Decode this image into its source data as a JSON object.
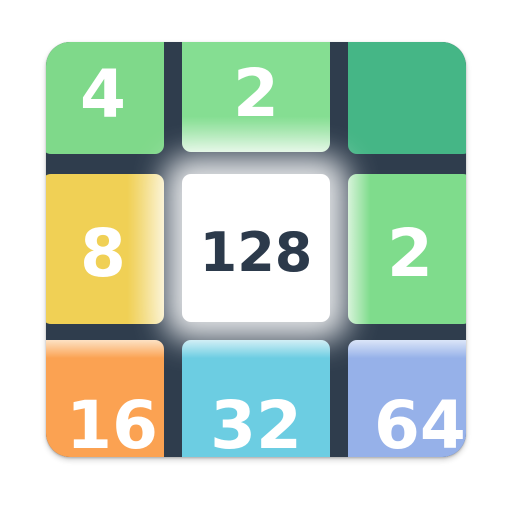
{
  "board": {
    "tiles": [
      {
        "value": "4",
        "color": "#7fd98a"
      },
      {
        "value": "2",
        "color": "#85de92"
      },
      {
        "value": "",
        "color": "#45b686"
      },
      {
        "value": "8",
        "color": "#f0d055"
      },
      {
        "value": "128",
        "color": "#ffffff"
      },
      {
        "value": "2",
        "color": "#7fdc8c"
      },
      {
        "value": "16",
        "color": "#fba252"
      },
      {
        "value": "32",
        "color": "#6ccde2"
      },
      {
        "value": "64",
        "color": "#96b1e9"
      }
    ],
    "frame_color": "#2f3d4d"
  }
}
